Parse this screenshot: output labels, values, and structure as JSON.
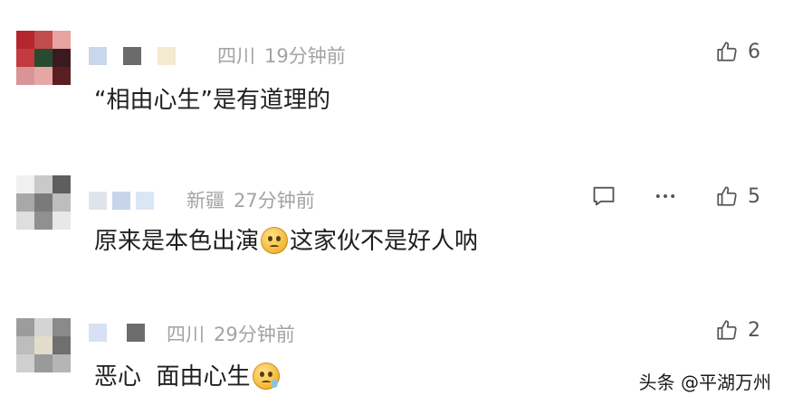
{
  "comments": [
    {
      "location": "四川",
      "time": "19分钟前",
      "text": "“相由心生”是有道理的",
      "likes": "6",
      "avatar_colors": [
        "#b3262e",
        "#c24b4b",
        "#e7a3a0",
        "#c23a3d",
        "#284a30",
        "#3a1a20",
        "#d89496",
        "#e6a6a6",
        "#5a1d22"
      ],
      "name_block_colors": [
        "#c9d7ec",
        "#6b6b6b",
        "#f3ead2"
      ]
    },
    {
      "location": "新疆",
      "time": "27分钟前",
      "text_before_emoji": "原来是本色出演",
      "text_after_emoji": "这家伙不是好人呐",
      "likes": "5",
      "avatar_colors": [
        "#f0f0f0",
        "#c9c9c9",
        "#5e5e5e",
        "#a8a8a8",
        "#7a7a7a",
        "#bdbdbd",
        "#dedede",
        "#909090",
        "#e8e8e8"
      ],
      "name_block_colors": [
        "#dfe4ec",
        "#c8d4ea",
        "#dbe6f5"
      ]
    },
    {
      "location": "四川",
      "time": "29分钟前",
      "text_before_emoji": "恶心  面由心生",
      "likes": "2",
      "avatar_colors": [
        "#9c9c9c",
        "#d4d4d4",
        "#8a8a8a",
        "#bdbdbd",
        "#e3dcc8",
        "#6f6f6f",
        "#cfcfcf",
        "#9a9a9a",
        "#b5b5b5"
      ],
      "name_block_colors": [
        "#d6e2f3",
        "#6d6d6d"
      ]
    }
  ],
  "icons": {
    "like": "thumbs-up-icon",
    "reply": "comment-bubble-icon",
    "more": "more-dots-icon"
  },
  "watermark": "头条 @平湖万州"
}
